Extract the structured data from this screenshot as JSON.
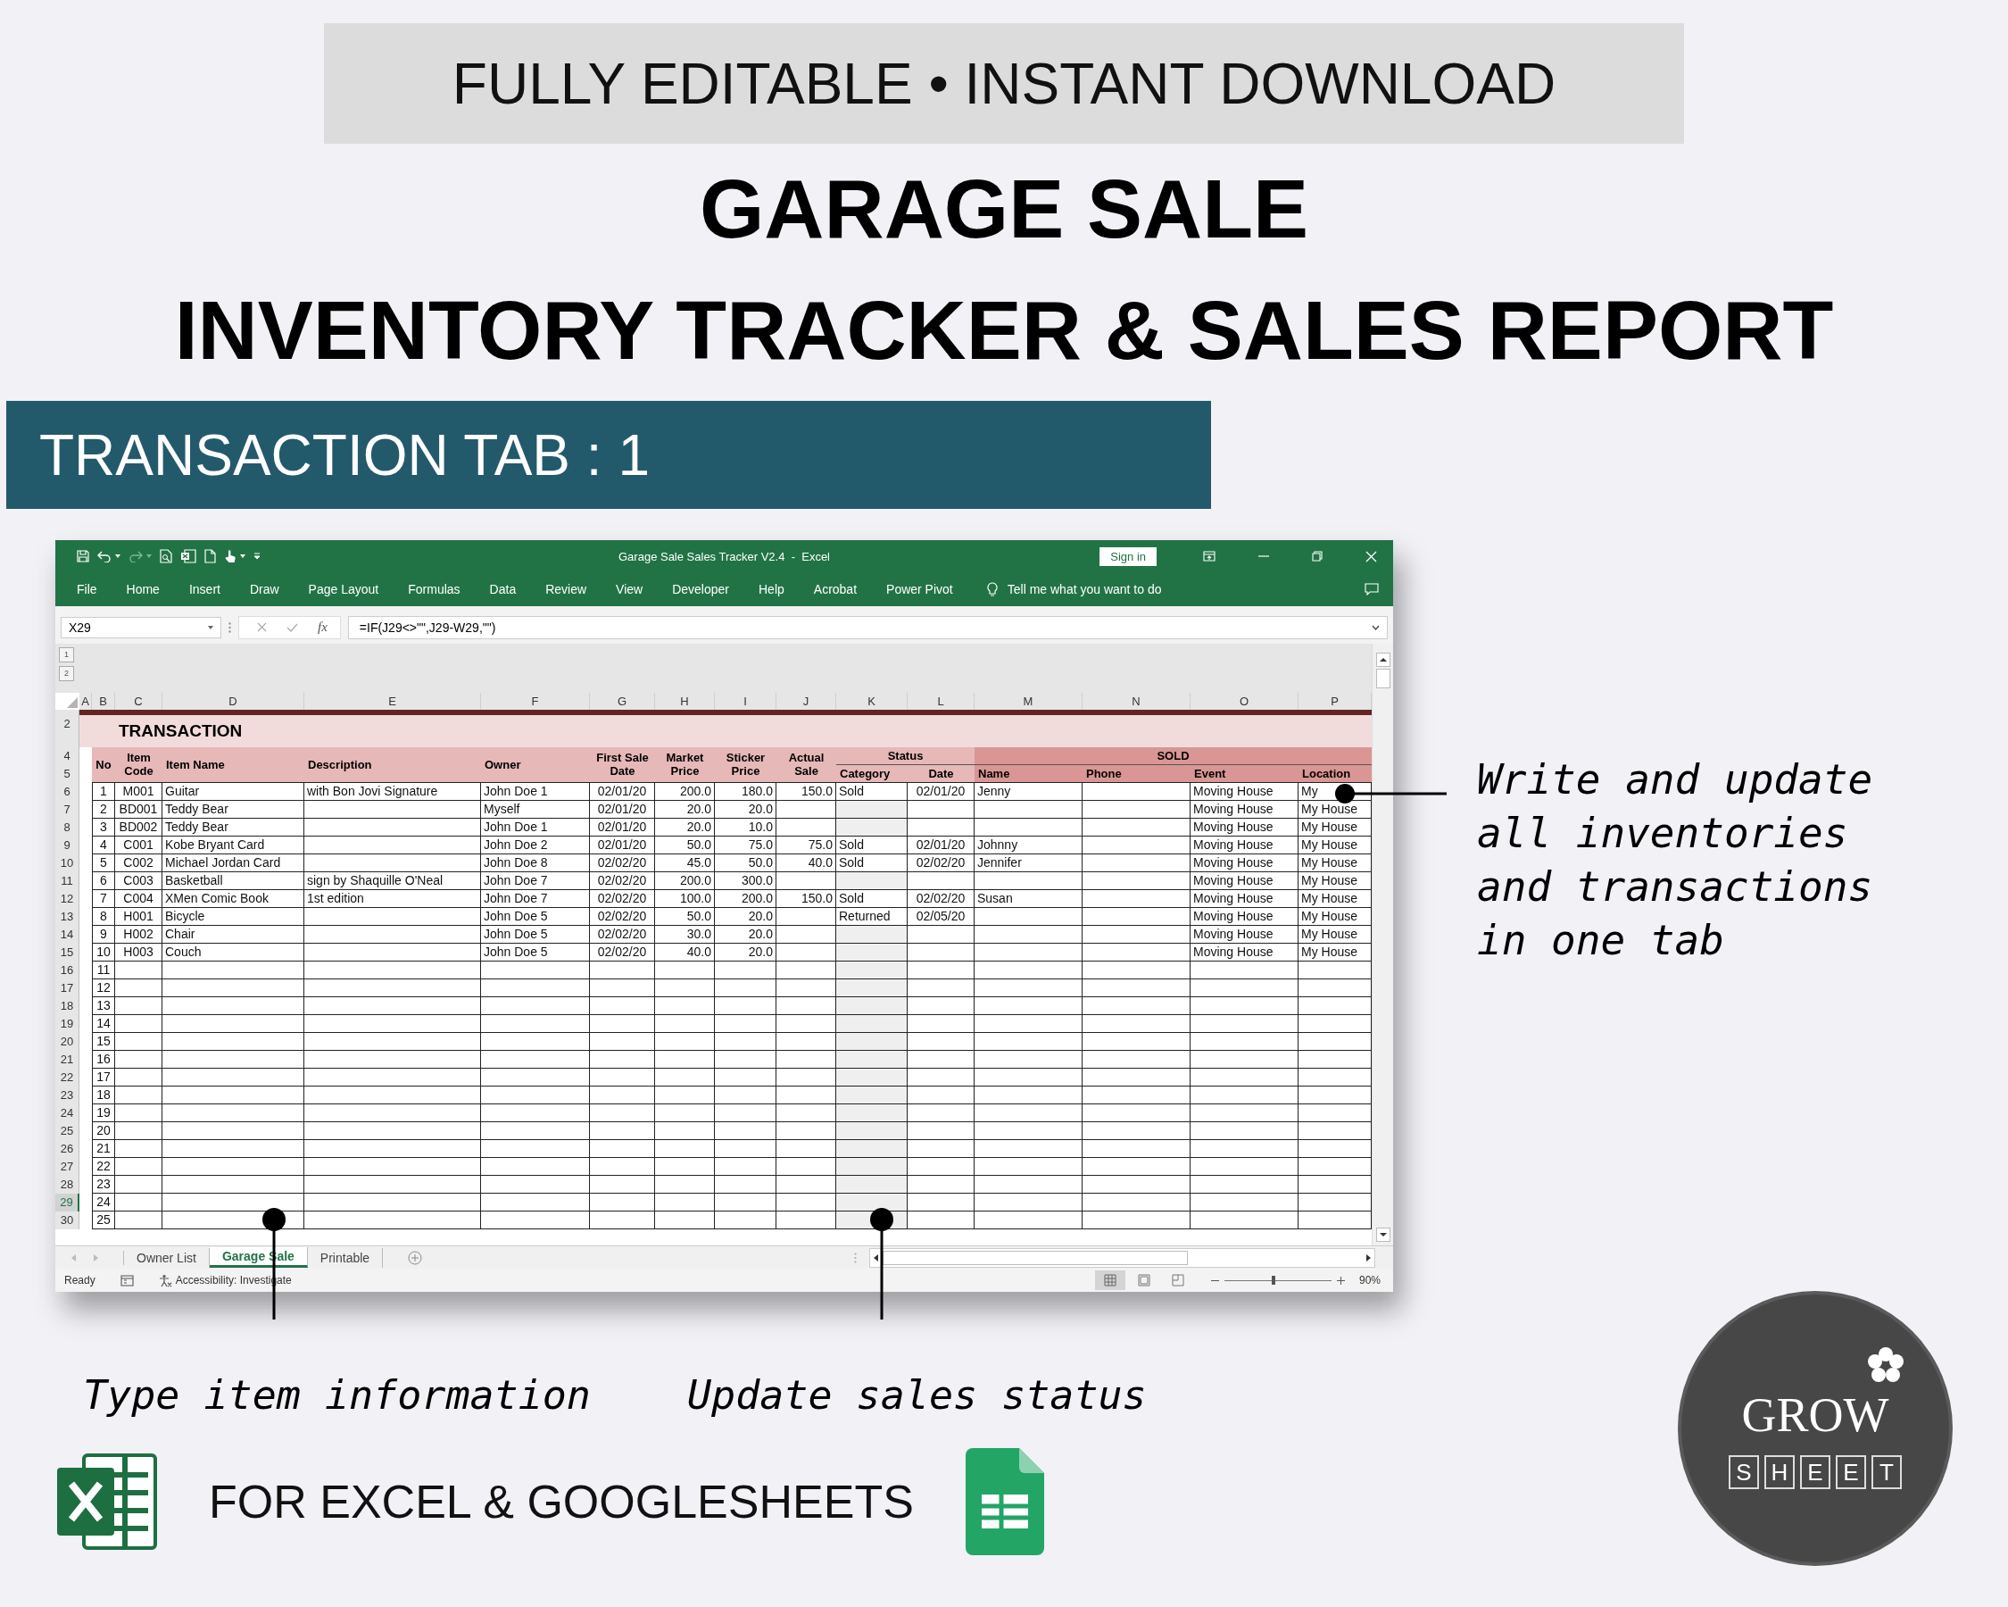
{
  "banner": "FULLY EDITABLE • INSTANT DOWNLOAD",
  "title_lines": [
    "GARAGE SALE",
    "INVENTORY TRACKER & SALES REPORT"
  ],
  "section_label": "TRANSACTION TAB : 1",
  "excel": {
    "window_title": "Garage Sale Sales Tracker V2.4  -  Excel",
    "sign_in": "Sign in",
    "ribbon_tabs": [
      "File",
      "Home",
      "Insert",
      "Draw",
      "Page Layout",
      "Formulas",
      "Data",
      "Review",
      "View",
      "Developer",
      "Help",
      "Acrobat",
      "Power Pivot"
    ],
    "tell_me": "Tell me what you want to do",
    "name_box": "X29",
    "function_label": "fx",
    "formula": "=IF(J29<>\"\",J29-W29,\"\")",
    "outline_levels": [
      "1",
      "2"
    ],
    "column_letters": [
      "A",
      "B",
      "C",
      "D",
      "E",
      "F",
      "G",
      "H",
      "I",
      "J",
      "K",
      "L",
      "M",
      "N",
      "O",
      "P"
    ],
    "title_row": {
      "row": "2",
      "title": "TRANSACTION"
    },
    "header_rows": [
      "4",
      "5"
    ],
    "header_columns": [
      "No",
      "Item Code",
      "Item Name",
      "Description",
      "Owner",
      "First Sale Date",
      "Market Price",
      "Sticker Price",
      "Actual Sale"
    ],
    "header_groups": [
      {
        "label": "Status",
        "columns": [
          "Category",
          "Date"
        ]
      },
      {
        "label": "SOLD",
        "columns": [
          "Name",
          "Phone",
          "Event",
          "Location"
        ]
      }
    ],
    "rows": [
      {
        "row": "6",
        "selected": false,
        "no": "1",
        "item_code": "M001",
        "item_name": "Guitar",
        "description": "with Bon Jovi Signature",
        "owner": "John Doe 1",
        "first_sale_date": "02/01/20",
        "market_price": "200.0",
        "sticker_price": "180.0",
        "actual_sale": "150.0",
        "category": "Sold",
        "status_date": "02/01/20",
        "name": "Jenny",
        "event": "Moving House",
        "location": "My"
      },
      {
        "row": "7",
        "selected": false,
        "no": "2",
        "item_code": "BD001",
        "item_name": "Teddy Bear",
        "owner": "Myself",
        "first_sale_date": "02/01/20",
        "market_price": "20.0",
        "sticker_price": "20.0",
        "event": "Moving House",
        "location": "My House"
      },
      {
        "row": "8",
        "selected": false,
        "no": "3",
        "item_code": "BD002",
        "item_name": "Teddy Bear",
        "owner": "John Doe 1",
        "first_sale_date": "02/01/20",
        "market_price": "20.0",
        "sticker_price": "10.0",
        "event": "Moving House",
        "location": "My House"
      },
      {
        "row": "9",
        "selected": false,
        "no": "4",
        "item_code": "C001",
        "item_name": "Kobe Bryant Card",
        "owner": "John Doe 2",
        "first_sale_date": "02/01/20",
        "market_price": "50.0",
        "sticker_price": "75.0",
        "actual_sale": "75.0",
        "category": "Sold",
        "status_date": "02/01/20",
        "name": "Johnny",
        "event": "Moving House",
        "location": "My House"
      },
      {
        "row": "10",
        "selected": false,
        "no": "5",
        "item_code": "C002",
        "item_name": "Michael Jordan Card",
        "owner": "John Doe 8",
        "first_sale_date": "02/02/20",
        "market_price": "45.0",
        "sticker_price": "50.0",
        "actual_sale": "40.0",
        "category": "Sold",
        "status_date": "02/02/20",
        "name": "Jennifer",
        "event": "Moving House",
        "location": "My House"
      },
      {
        "row": "11",
        "selected": false,
        "no": "6",
        "item_code": "C003",
        "item_name": "Basketball",
        "description": "sign by Shaquille O'Neal",
        "owner": "John Doe 7",
        "first_sale_date": "02/02/20",
        "market_price": "200.0",
        "sticker_price": "300.0",
        "event": "Moving House",
        "location": "My House"
      },
      {
        "row": "12",
        "selected": false,
        "no": "7",
        "item_code": "C004",
        "item_name": "XMen Comic Book",
        "description": "1st edition",
        "owner": "John Doe 7",
        "first_sale_date": "02/02/20",
        "market_price": "100.0",
        "sticker_price": "200.0",
        "actual_sale": "150.0",
        "category": "Sold",
        "status_date": "02/02/20",
        "name": "Susan",
        "event": "Moving House",
        "location": "My House"
      },
      {
        "row": "13",
        "selected": false,
        "no": "8",
        "item_code": "H001",
        "item_name": "Bicycle",
        "owner": "John Doe 5",
        "first_sale_date": "02/02/20",
        "market_price": "50.0",
        "sticker_price": "20.0",
        "category": "Returned",
        "status_date": "02/05/20",
        "event": "Moving House",
        "location": "My House"
      },
      {
        "row": "14",
        "selected": false,
        "no": "9",
        "item_code": "H002",
        "item_name": "Chair",
        "owner": "John Doe 5",
        "first_sale_date": "02/02/20",
        "market_price": "30.0",
        "sticker_price": "20.0",
        "event": "Moving House",
        "location": "My House"
      },
      {
        "row": "15",
        "selected": false,
        "no": "10",
        "item_code": "H003",
        "item_name": "Couch",
        "owner": "John Doe 5",
        "first_sale_date": "02/02/20",
        "market_price": "40.0",
        "sticker_price": "20.0",
        "event": "Moving House",
        "location": "My House"
      },
      {
        "row": "16",
        "selected": false,
        "no": "11"
      },
      {
        "row": "17",
        "selected": false,
        "no": "12"
      },
      {
        "row": "18",
        "selected": false,
        "no": "13"
      },
      {
        "row": "19",
        "selected": false,
        "no": "14"
      },
      {
        "row": "20",
        "selected": false,
        "no": "15"
      },
      {
        "row": "21",
        "selected": false,
        "no": "16"
      },
      {
        "row": "22",
        "selected": false,
        "no": "17"
      },
      {
        "row": "23",
        "selected": false,
        "no": "18"
      },
      {
        "row": "24",
        "selected": false,
        "no": "19"
      },
      {
        "row": "25",
        "selected": false,
        "no": "20"
      },
      {
        "row": "26",
        "selected": false,
        "no": "21"
      },
      {
        "row": "27",
        "selected": false,
        "no": "22"
      },
      {
        "row": "28",
        "selected": false,
        "no": "23"
      },
      {
        "row": "29",
        "selected": true,
        "no": "24"
      },
      {
        "row": "30",
        "selected": false,
        "no": "25"
      }
    ],
    "sheet_tabs": [
      {
        "label": "Owner List",
        "selected": false
      },
      {
        "label": "Garage Sale",
        "selected": true
      },
      {
        "label": "Printable",
        "selected": false
      }
    ],
    "status": "Ready",
    "accessibility": "Accessibility: Investigate",
    "zoom_slider": {
      "level": 0.46
    },
    "zoom": "90%"
  },
  "side_note": "Write and update all inventories and transactions in one tab",
  "bottom_notes": [
    "Type item information",
    "Update sales status"
  ],
  "platforms": "FOR EXCEL & GOOGLESHEETS",
  "logo": {
    "word": "GROW",
    "letters": [
      "S",
      "H",
      "E",
      "E",
      "T"
    ]
  }
}
